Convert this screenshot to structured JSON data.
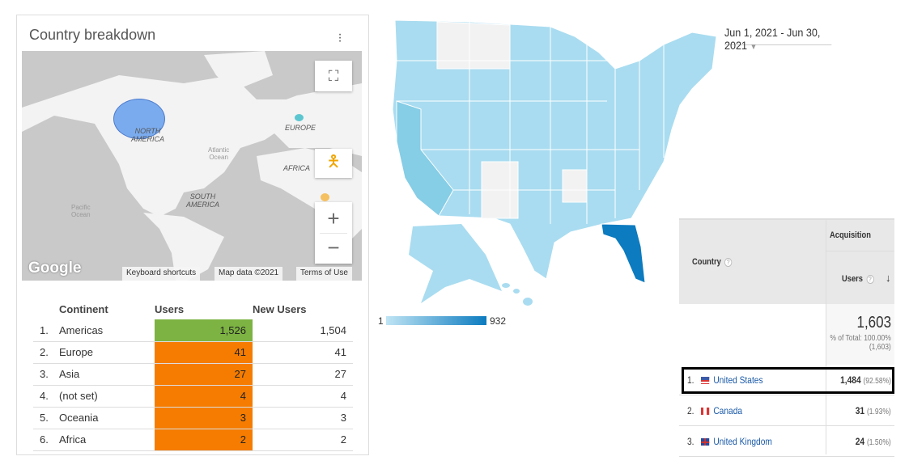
{
  "card": {
    "title": "Country breakdown",
    "menu_icon": "more-vert-icon"
  },
  "map": {
    "labels": {
      "north_america": "NORTH\nAMERICA",
      "europe": "EUROPE",
      "africa": "AFRICA",
      "south_america": "SOUTH\nAMERICA",
      "atlantic": "Atlantic\nOcean",
      "pacific": "Pacific\nOcean"
    },
    "logo": "Google",
    "attribution": [
      "Keyboard shortcuts",
      "Map data ©2021",
      "Terms of Use"
    ],
    "bubble_colors": {
      "americas": "#6ea4ee",
      "europe": "#5cc6d0",
      "africa": "#f5c060"
    }
  },
  "continent_table": {
    "headers": [
      "Continent",
      "Users",
      "New Users"
    ],
    "rows": [
      {
        "rank": "1.",
        "name": "Americas",
        "users": "1,526",
        "new_users": "1,504",
        "color": "#7cb342"
      },
      {
        "rank": "2.",
        "name": "Europe",
        "users": "41",
        "new_users": "41",
        "color": "#f57c00"
      },
      {
        "rank": "3.",
        "name": "Asia",
        "users": "27",
        "new_users": "27",
        "color": "#f57c00"
      },
      {
        "rank": "4.",
        "name": "(not set)",
        "users": "4",
        "new_users": "4",
        "color": "#f57c00"
      },
      {
        "rank": "5.",
        "name": "Oceania",
        "users": "3",
        "new_users": "3",
        "color": "#f57c00"
      },
      {
        "rank": "6.",
        "name": "Africa",
        "users": "2",
        "new_users": "2",
        "color": "#f57c00"
      }
    ]
  },
  "date_range": "Jun 1, 2021 - Jun 30, 2021",
  "us_map": {
    "legend_min": "1",
    "legend_max": "932",
    "colors": {
      "light": "#a9dcf0",
      "dark": "#0c7bbf",
      "none": "#f2f2f2"
    }
  },
  "country_table": {
    "group_header": "Acquisition",
    "country_header": "Country",
    "users_header": "Users",
    "total": "1,603",
    "total_pct": "% of Total: 100.00%",
    "total_abs": "(1,603)",
    "rows": [
      {
        "rank": "1.",
        "country": "United States",
        "users": "1,484",
        "pct": "(92.58%)"
      },
      {
        "rank": "2.",
        "country": "Canada",
        "users": "31",
        "pct": "(1.93%)"
      },
      {
        "rank": "3.",
        "country": "United Kingdom",
        "users": "24",
        "pct": "(1.50%)"
      }
    ]
  }
}
